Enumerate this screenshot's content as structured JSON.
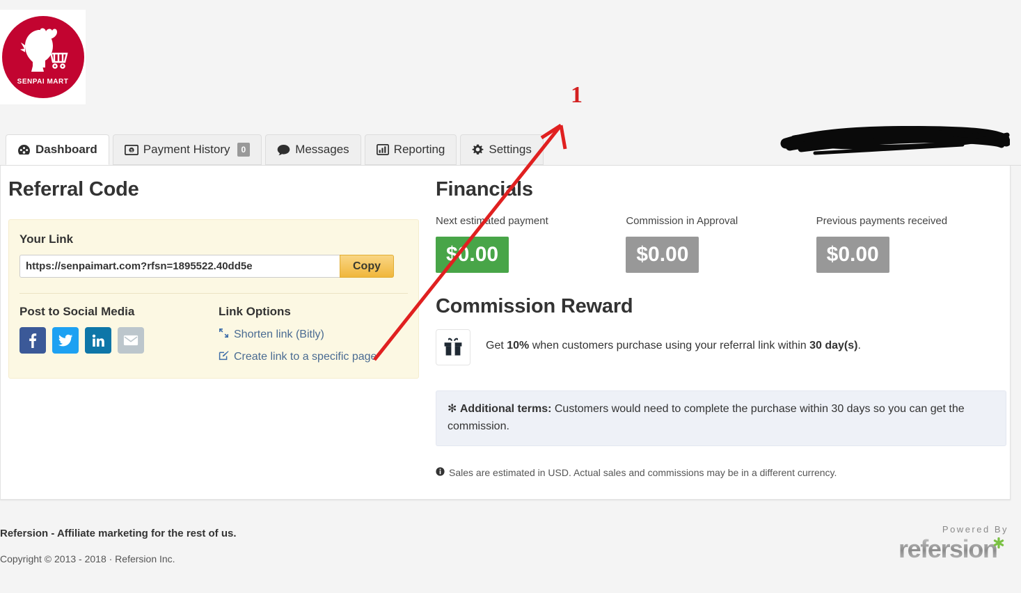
{
  "brand": {
    "logo_text": "SENPAI MART",
    "logo_color": "#c20430"
  },
  "tabs": [
    {
      "label": "Dashboard",
      "icon": "dashboard-icon",
      "active": true,
      "badge": null
    },
    {
      "label": "Payment History",
      "icon": "money-bill-icon",
      "active": false,
      "badge": "0"
    },
    {
      "label": "Messages",
      "icon": "comment-icon",
      "active": false,
      "badge": null
    },
    {
      "label": "Reporting",
      "icon": "bar-chart-icon",
      "active": false,
      "badge": null
    },
    {
      "label": "Settings",
      "icon": "gear-icon",
      "active": false,
      "badge": null
    }
  ],
  "referral": {
    "heading": "Referral Code",
    "your_link_label": "Your Link",
    "link_value": "https://senpaimart.com?rfsn=1895522.40dd5e",
    "link_placeholder": "https://",
    "copy_label": "Copy",
    "social_heading": "Post to Social Media",
    "social": [
      {
        "name": "facebook-icon",
        "color": "#3b5998"
      },
      {
        "name": "twitter-icon",
        "color": "#1da1f2"
      },
      {
        "name": "linkedin-icon",
        "color": "#0e76a8"
      },
      {
        "name": "email-icon",
        "color": "#bcc6cc"
      }
    ],
    "options_heading": "Link Options",
    "options": [
      {
        "label": "Shorten link (Bitly)",
        "icon": "compress-arrows-icon"
      },
      {
        "label": "Create link to a specific page",
        "icon": "pencil-square-icon"
      }
    ]
  },
  "financials": {
    "heading": "Financials",
    "cells": [
      {
        "label": "Next estimated payment",
        "value": "$0.00",
        "color": "#48a548"
      },
      {
        "label": "Commission in Approval",
        "value": "$0.00",
        "color": "#989898"
      },
      {
        "label": "Previous payments received",
        "value": "$0.00",
        "color": "#989898"
      }
    ]
  },
  "reward": {
    "heading": "Commission Reward",
    "icon": "gift-icon",
    "text_pre": "Get ",
    "percent": "10%",
    "text_mid": " when customers purchase using your referral link within ",
    "days": "30 day(s)",
    "text_post": ".",
    "terms_label": "Additional terms:",
    "terms_text": " Customers would need to complete the purchase within 30 days so you can get the commission.",
    "currency_note": "Sales are estimated in USD. Actual sales and commissions may be in a different currency."
  },
  "footer": {
    "tagline": "Refersion - Affiliate marketing for the rest of us.",
    "copyright": "Copyright © 2013 - 2018 · Refersion Inc.",
    "powered_by": "Powered By",
    "powered_brand": "refersion"
  },
  "annotation": {
    "number": "1",
    "color": "#d32020"
  }
}
